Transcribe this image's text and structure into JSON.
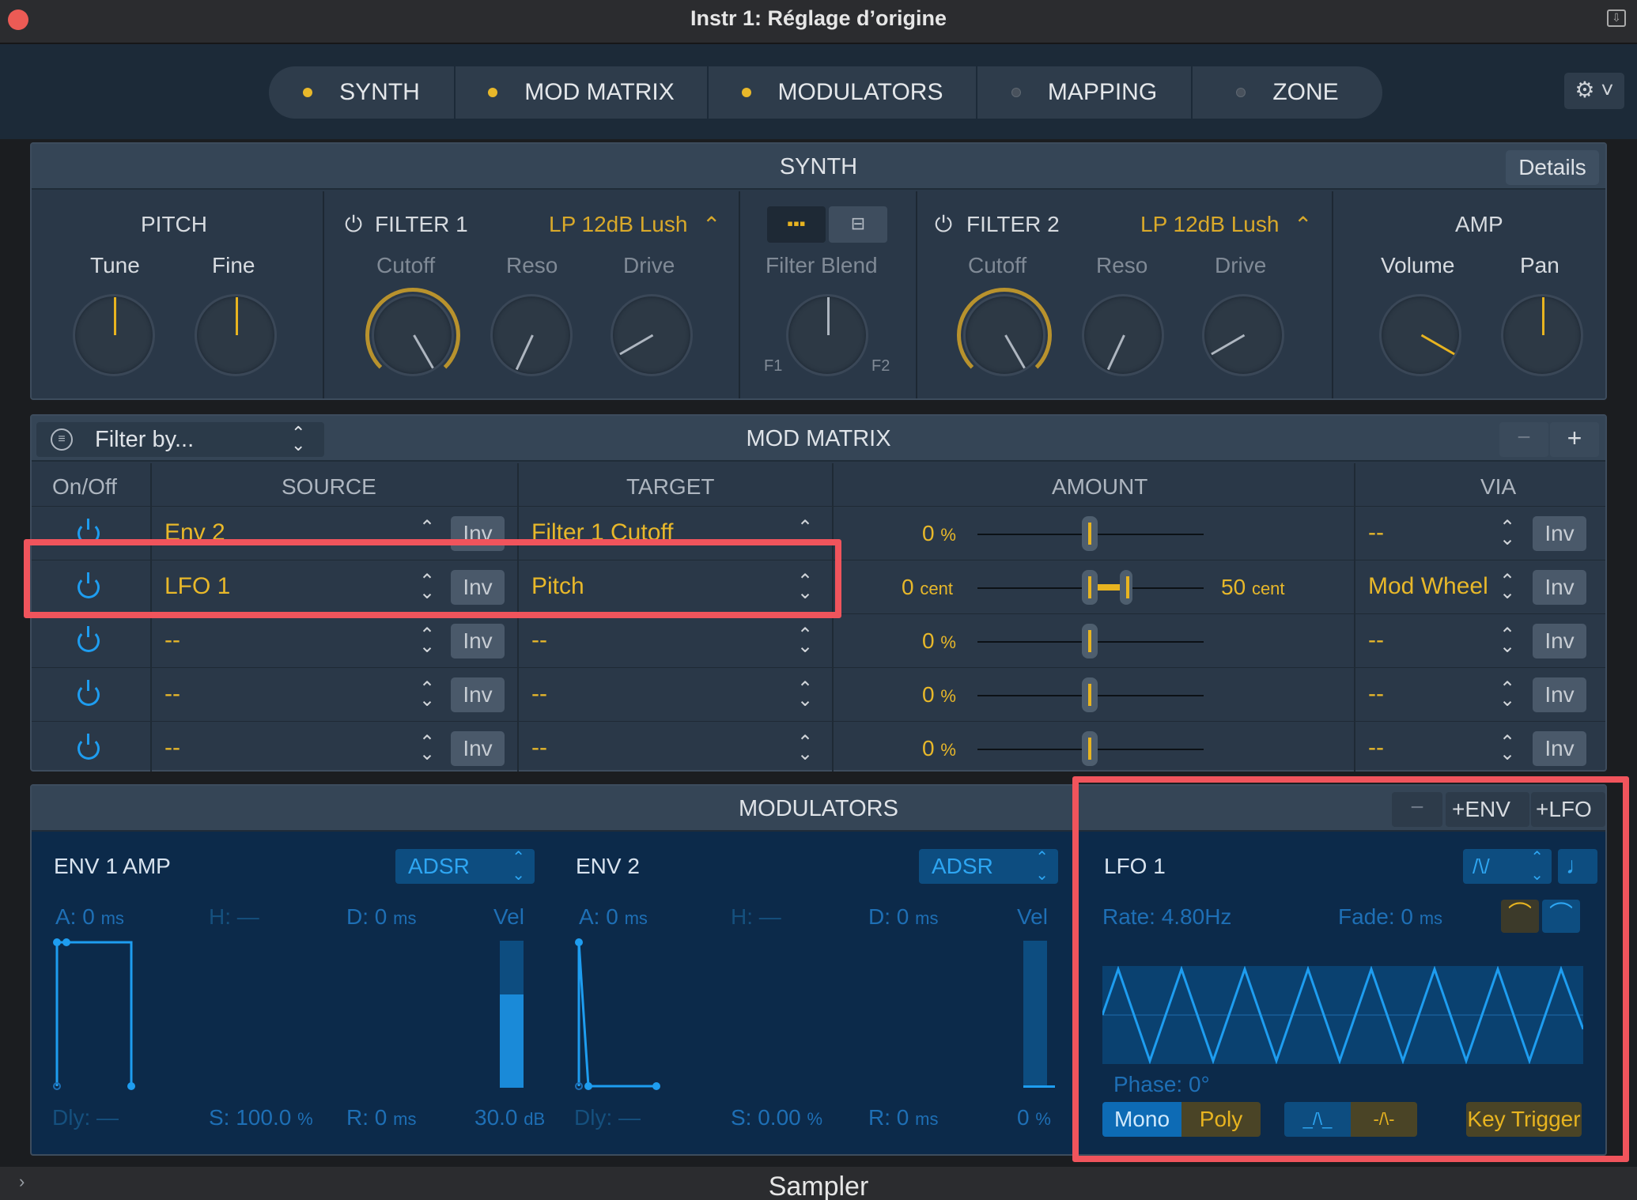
{
  "window": {
    "title": "Instr 1: Réglage d’origine",
    "footer_title": "Sampler"
  },
  "tabs": [
    {
      "label": "SYNTH",
      "active": true
    },
    {
      "label": "MOD MATRIX",
      "active": true
    },
    {
      "label": "MODULATORS",
      "active": true
    },
    {
      "label": "MAPPING",
      "active": false
    },
    {
      "label": "ZONE",
      "active": false
    }
  ],
  "synth": {
    "header": "SYNTH",
    "details_label": "Details",
    "pitch": {
      "title": "PITCH",
      "tune": "Tune",
      "fine": "Fine"
    },
    "filter1": {
      "title": "FILTER 1",
      "type": "LP 12dB Lush",
      "cutoff": "Cutoff",
      "reso": "Reso",
      "drive": "Drive"
    },
    "blend": {
      "label": "Filter Blend",
      "f1": "F1",
      "f2": "F2"
    },
    "filter2": {
      "title": "FILTER 2",
      "type": "LP 12dB Lush",
      "cutoff": "Cutoff",
      "reso": "Reso",
      "drive": "Drive"
    },
    "amp": {
      "title": "AMP",
      "volume": "Volume",
      "pan": "Pan"
    }
  },
  "mod_matrix": {
    "header": "MOD MATRIX",
    "filter_placeholder": "Filter by...",
    "columns": {
      "onoff": "On/Off",
      "source": "SOURCE",
      "target": "TARGET",
      "amount": "AMOUNT",
      "via": "VIA"
    },
    "inv_label": "Inv",
    "rows": [
      {
        "source": "Env 2",
        "target": "Filter 1 Cutoff",
        "amount": "0",
        "amount_unit": "%",
        "via": "--"
      },
      {
        "source": "LFO 1",
        "target": "Pitch",
        "amount": "0",
        "amount_unit": "cent",
        "range": "50",
        "range_unit": "cent",
        "via": "Mod Wheel"
      },
      {
        "source": "--",
        "target": "--",
        "amount": "0",
        "amount_unit": "%",
        "via": "--"
      },
      {
        "source": "--",
        "target": "--",
        "amount": "0",
        "amount_unit": "%",
        "via": "--"
      },
      {
        "source": "--",
        "target": "--",
        "amount": "0",
        "amount_unit": "%",
        "via": "--"
      }
    ]
  },
  "modulators": {
    "header": "MODULATORS",
    "add_env": "ENV",
    "add_lfo": "LFO",
    "env1": {
      "title": "ENV 1 AMP",
      "mode": "ADSR",
      "a": "A: 0",
      "a_unit": "ms",
      "h": "H: —",
      "d": "D: 0",
      "d_unit": "ms",
      "vel": "Vel",
      "dly": "Dly: —",
      "s": "S: 100.0",
      "s_unit": "%",
      "r": "R: 0",
      "r_unit": "ms",
      "vel_val": "30.0",
      "vel_unit": "dB"
    },
    "env2": {
      "title": "ENV 2",
      "mode": "ADSR",
      "a": "A: 0",
      "a_unit": "ms",
      "h": "H: —",
      "d": "D: 0",
      "d_unit": "ms",
      "vel": "Vel",
      "dly": "Dly: —",
      "s": "S: 0.00",
      "s_unit": "%",
      "r": "R: 0",
      "r_unit": "ms",
      "vel_val": "0",
      "vel_unit": "%"
    },
    "lfo1": {
      "title": "LFO 1",
      "rate": "Rate: 4.80Hz",
      "fade": "Fade: 0",
      "fade_unit": "ms",
      "phase": "Phase: 0°",
      "mono": "Mono",
      "poly": "Poly",
      "key_trigger": "Key Trigger"
    }
  },
  "colors": {
    "accent_gold": "#e8b82a",
    "accent_blue": "#1e9df0",
    "highlight_red": "#f0545c"
  }
}
